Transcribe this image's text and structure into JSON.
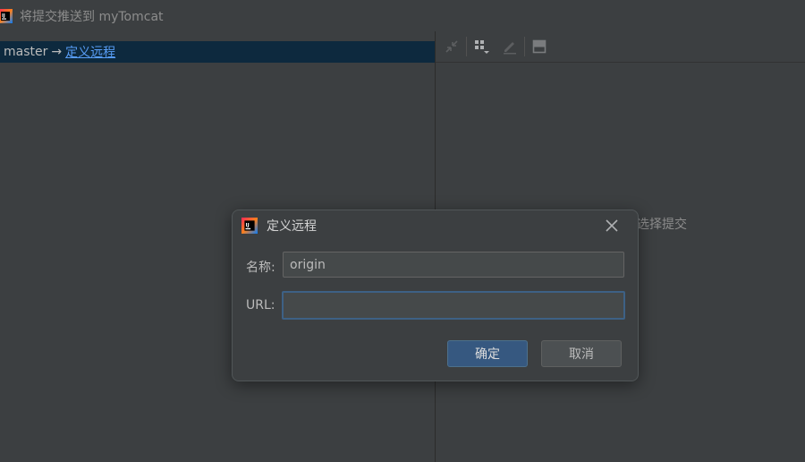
{
  "window": {
    "title": "将提交推送到 myTomcat"
  },
  "left_pane": {
    "branch": "master",
    "arrow": "→",
    "remote_link": "定义远程"
  },
  "right_pane": {
    "toolbar_icons": [
      "collapse-icon",
      "group-by-icon",
      "edit-icon",
      "layout-icon"
    ],
    "placeholder": "选择提交"
  },
  "dialog": {
    "title": "定义远程",
    "name_label": "名称:",
    "name_value": "origin",
    "url_label": "URL:",
    "url_value": "",
    "ok_label": "确定",
    "cancel_label": "取消"
  },
  "colors": {
    "background": "#3c3f41",
    "selection": "#0d293e",
    "link": "#589df6",
    "primary_button": "#365880",
    "focus_border": "#3d6185"
  }
}
